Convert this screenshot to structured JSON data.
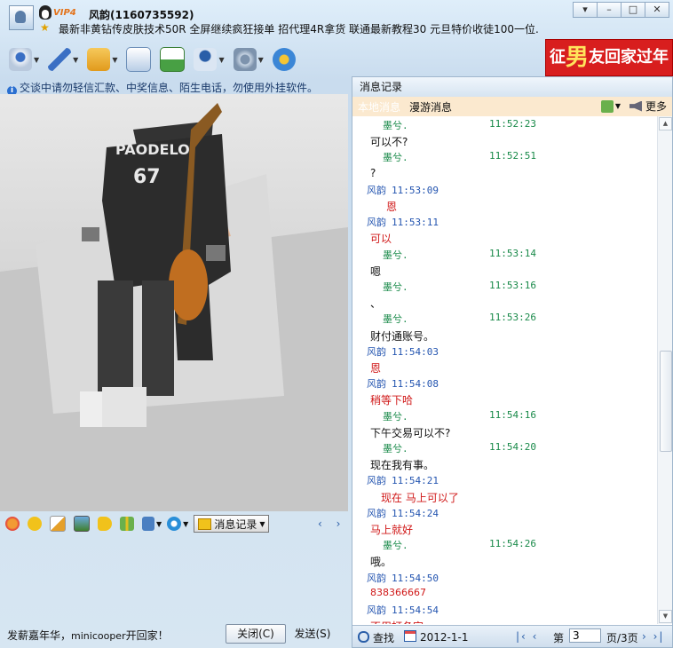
{
  "titlebar": {
    "vip_label": "VIP4",
    "nickname": "风韵(1160735592)",
    "signature": "最新非黄钻传皮肤技术50R 全屏继续疯狂接单 招代理4R拿货 联通最新教程30  元旦特价收徒100一位.",
    "buttons": [
      "▾",
      "–",
      "□",
      "✕"
    ]
  },
  "toolbar": {
    "icons": [
      "webcam-icon",
      "microphone-icon",
      "folder-send-icon",
      "mail-icon",
      "add-contact-icon",
      "user-info-icon",
      "settings-icon",
      "app-icon"
    ]
  },
  "ad_banner": {
    "text_a": "征",
    "text_big": "男",
    "text_b": "友回家过年"
  },
  "notice": "交谈中请勿轻信汇款、中奖信息、陌生电话，勿使用外挂软件。",
  "mid_toolbar": {
    "icons": [
      "font-icon",
      "emoji-icon",
      "doodle-icon",
      "image-icon",
      "music-icon",
      "gift-icon",
      "screenshot-icon",
      "sogou-icon"
    ],
    "message_record_label": "消息记录",
    "nav": "‹  ›"
  },
  "status": {
    "prefix": "发薪嘉年华，",
    "user": "minicooper",
    "suffix": "开回家！"
  },
  "buttons": {
    "close": "关闭(C)",
    "send": "发送(S)"
  },
  "history": {
    "title": "消息记录",
    "tab_local": "本地消息",
    "tab_roam": "漫游消息",
    "more_label": "更多",
    "messages": [
      {
        "sender": "墨兮.",
        "time": "11:52:23",
        "type": "m",
        "text": "可以不?"
      },
      {
        "sender": "墨兮.",
        "time": "11:52:51",
        "type": "m",
        "text": "?"
      },
      {
        "sender": "风韵",
        "time": "11:53:09",
        "type": "f",
        "text": "恩"
      },
      {
        "sender": "风韵",
        "time": "11:53:11",
        "type": "f",
        "text": "可以"
      },
      {
        "sender": "墨兮.",
        "time": "11:53:14",
        "type": "m",
        "text": "嗯"
      },
      {
        "sender": "墨兮.",
        "time": "11:53:16",
        "type": "m",
        "text": "、"
      },
      {
        "sender": "墨兮.",
        "time": "11:53:26",
        "type": "m",
        "text": "财付通账号。"
      },
      {
        "sender": "风韵",
        "time": "11:54:03",
        "type": "f",
        "text": "恩"
      },
      {
        "sender": "风韵",
        "time": "11:54:08",
        "type": "f",
        "text": "稍等下哈"
      },
      {
        "sender": "墨兮.",
        "time": "11:54:16",
        "type": "m",
        "text": "下午交易可以不?"
      },
      {
        "sender": "墨兮.",
        "time": "11:54:20",
        "type": "m",
        "text": "现在我有事。"
      },
      {
        "sender": "风韵",
        "time": "11:54:21",
        "type": "f",
        "text": "现在 马上可以了"
      },
      {
        "sender": "风韵",
        "time": "11:54:24",
        "type": "f",
        "text": "马上就好"
      },
      {
        "sender": "墨兮.",
        "time": "11:54:26",
        "type": "m",
        "text": "哦。"
      },
      {
        "sender": "风韵",
        "time": "11:54:50",
        "type": "f",
        "text": "838366667"
      },
      {
        "sender": "风韵",
        "time": "11:54:54",
        "type": "f",
        "text": "不用打冬字"
      }
    ],
    "footer": {
      "search_label": "查找",
      "date": "2012-1-1",
      "page_prefix": "第",
      "page_value": "3",
      "page_suffix": "页/3页"
    }
  },
  "colors": {
    "local_tab_text": "#ffffff",
    "self_sender": "#2455b0",
    "other_sender": "#1a8a4a",
    "self_text": "#d01818"
  }
}
